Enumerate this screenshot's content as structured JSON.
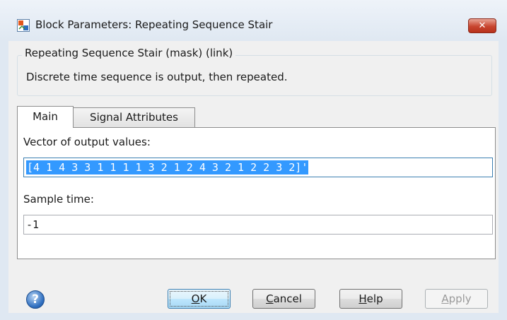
{
  "window": {
    "title": "Block Parameters: Repeating Sequence Stair",
    "close_label": "✕"
  },
  "group": {
    "legend": "Repeating Sequence Stair (mask) (link)",
    "description": "Discrete time sequence is output, then repeated."
  },
  "tabs": [
    {
      "label": "Main",
      "selected": true
    },
    {
      "label": "Signal Attributes",
      "selected": false
    }
  ],
  "fields": {
    "output_values": {
      "label": "Vector of output values:",
      "value": "[4 1 4 3 3 1 1 1 1 3 2 1 2 4 3 2 1 2 2 3 2]'"
    },
    "sample_time": {
      "label": "Sample time:",
      "value": "-1"
    }
  },
  "buttons": {
    "help_icon": "?",
    "ok": {
      "mnemonic": "O",
      "rest": "K"
    },
    "cancel": {
      "mnemonic": "C",
      "rest": "ancel"
    },
    "help": {
      "mnemonic": "H",
      "rest": "elp"
    },
    "apply": {
      "mnemonic": "A",
      "rest": "pply",
      "enabled": false
    }
  },
  "colors": {
    "selection": "#3399ff",
    "close_button": "#c8452f",
    "ok_focus": "#3c7fb1"
  }
}
